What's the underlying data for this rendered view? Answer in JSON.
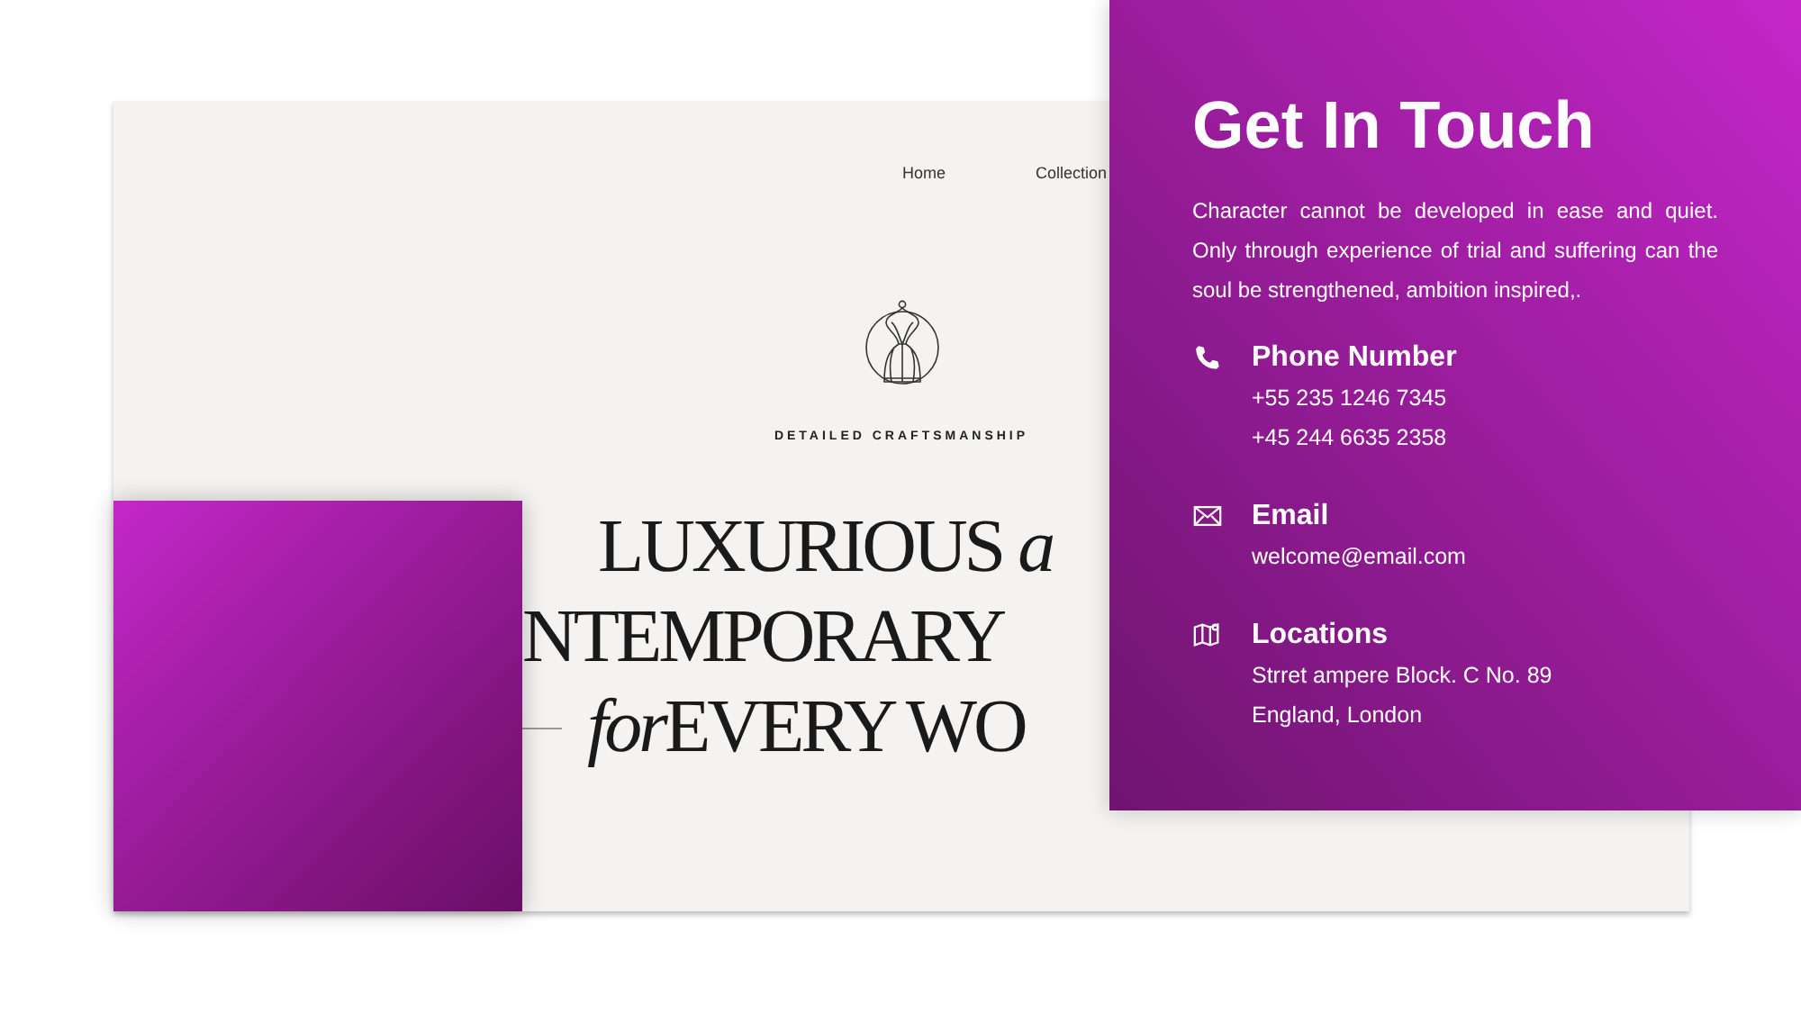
{
  "nav": [
    {
      "label": "Home"
    },
    {
      "label": "Collection"
    }
  ],
  "logo_caption": "DETAILED CRAFTSMANSHIP",
  "hero_lines": [
    {
      "text": "LUXURIOUS *a*",
      "dash": false
    },
    {
      "text": "NTEMPORARY",
      "dash": false
    },
    {
      "lead": "for",
      "text": "EVERY WO",
      "dash": true
    }
  ],
  "contact": {
    "title": "Get In Touch",
    "text": "Character cannot be developed in ease and quiet. Only through experience of trial and suffering can the soul be strengthened, ambition inspired,.",
    "items": [
      {
        "kind": "phone",
        "heading": "Phone Number",
        "lines": [
          "+55 235 1246 7345",
          "+45 244 6635 2358"
        ]
      },
      {
        "kind": "email",
        "heading": "Email",
        "lines": [
          "welcome@email.com"
        ]
      },
      {
        "kind": "location",
        "heading": "Locations",
        "lines": [
          "Strret ampere Block. C No. 89",
          "England, London"
        ]
      }
    ]
  }
}
